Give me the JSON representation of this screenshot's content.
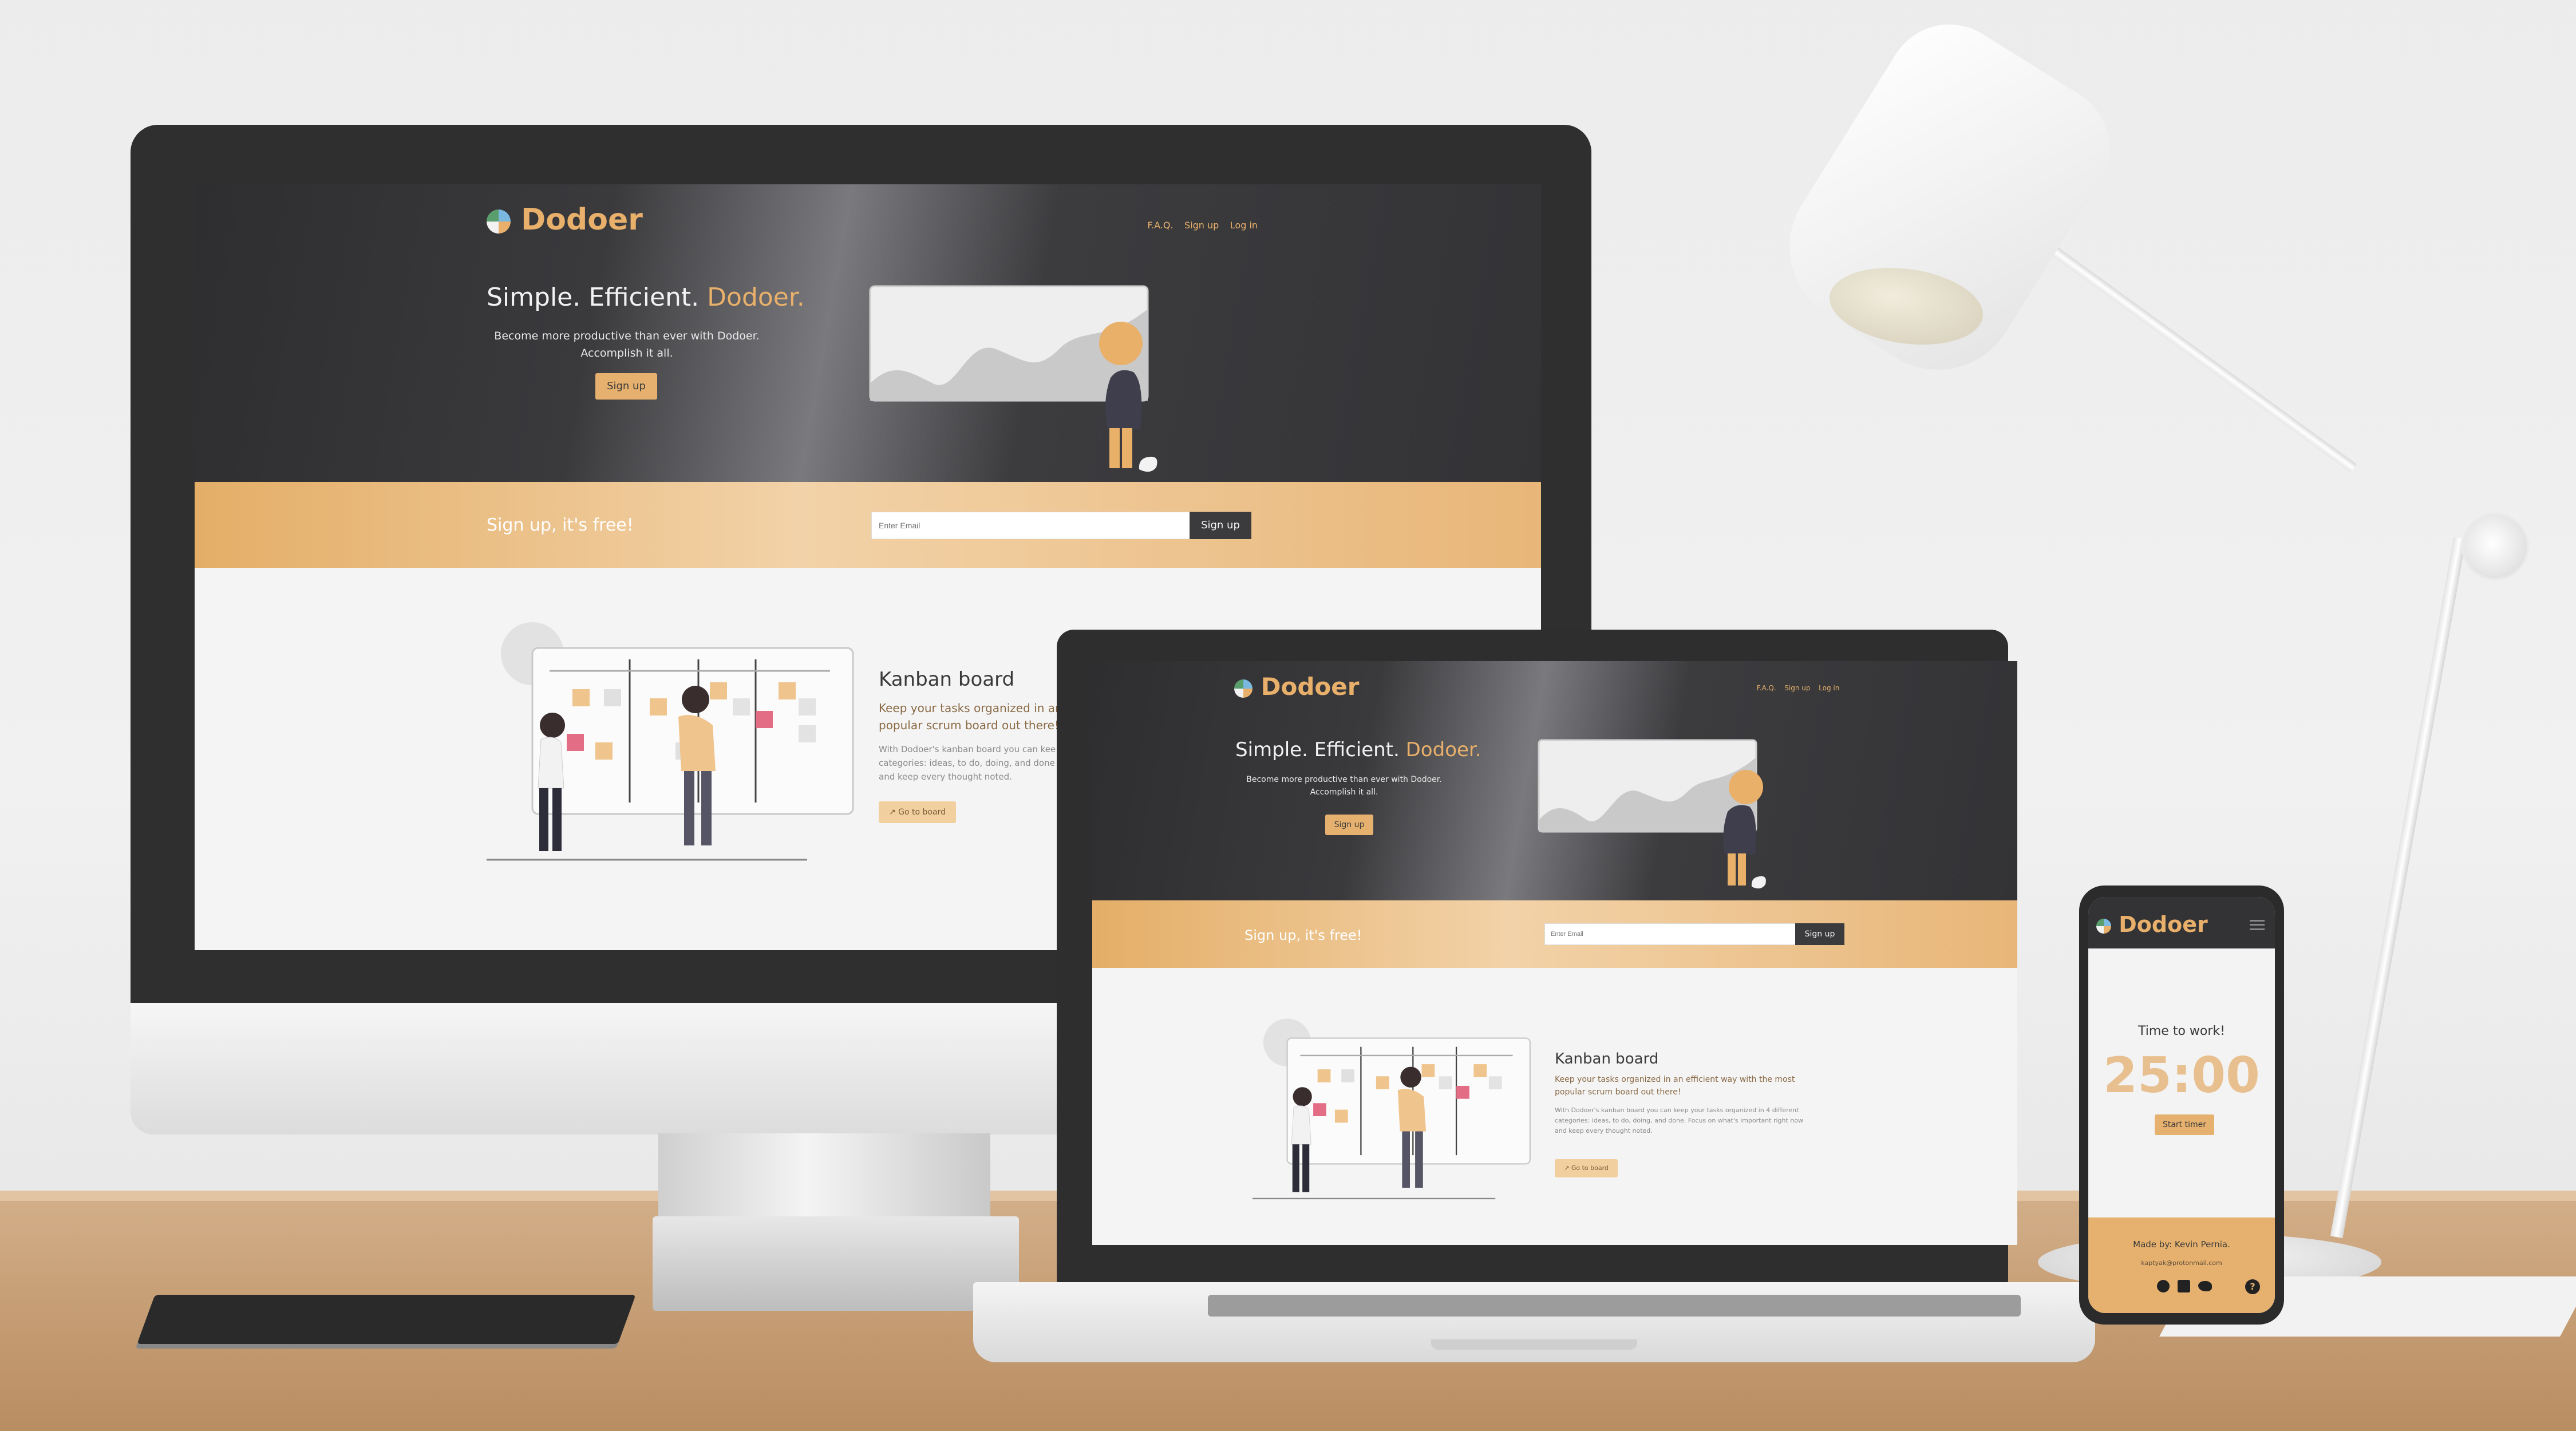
{
  "site": {
    "logo": "Dodoer",
    "nav": [
      "F.A.Q.",
      "Sign up",
      "Log in"
    ],
    "hero": {
      "title_prefix": "Simple. Efficient. ",
      "title_accent": "Dodoer.",
      "subtitle_line1": "Become more productive than ever with Dodoer.",
      "subtitle_line2": "Accomplish it all.",
      "signup_button": "Sign up"
    },
    "signup_band": {
      "title": "Sign up, it's free!",
      "email_placeholder": "Enter Email",
      "button": "Sign up"
    },
    "kanban": {
      "title": "Kanban board",
      "lead_monitor_1": "Keep your tasks organized in an",
      "lead_monitor_2": "popular scrum board out there!",
      "body_monitor_1": "With Dodoer's kanban board you can kee",
      "body_monitor_2": "categories: ideas, to do, doing, and done",
      "body_monitor_3": "and keep every thought noted.",
      "lead_laptop_1": "Keep your tasks organized in an efficient way with the most",
      "lead_laptop_2": "popular scrum board out there!",
      "body_laptop_1": "With Dodoer's kanban board you can keep your tasks organized in 4 different",
      "body_laptop_2": "categories: ideas, to do, doing, and done. Focus on what's important right now",
      "body_laptop_3": "and keep every thought noted.",
      "button": "↗ Go to board"
    },
    "mobile": {
      "menu_icon": "hamburger-icon",
      "timer_heading": "Time to work!",
      "timer_value": "25:00",
      "start_button": "Start timer",
      "footer_made_by": "Made by: Kevin Pernia.",
      "footer_email": "kaptyak@protonmail.com",
      "social_icons": [
        "github-icon",
        "linkedin-icon",
        "twitter-icon"
      ]
    }
  },
  "colors": {
    "accent": "#e8b06a",
    "dark": "#333336",
    "band": "#e4ae67"
  }
}
